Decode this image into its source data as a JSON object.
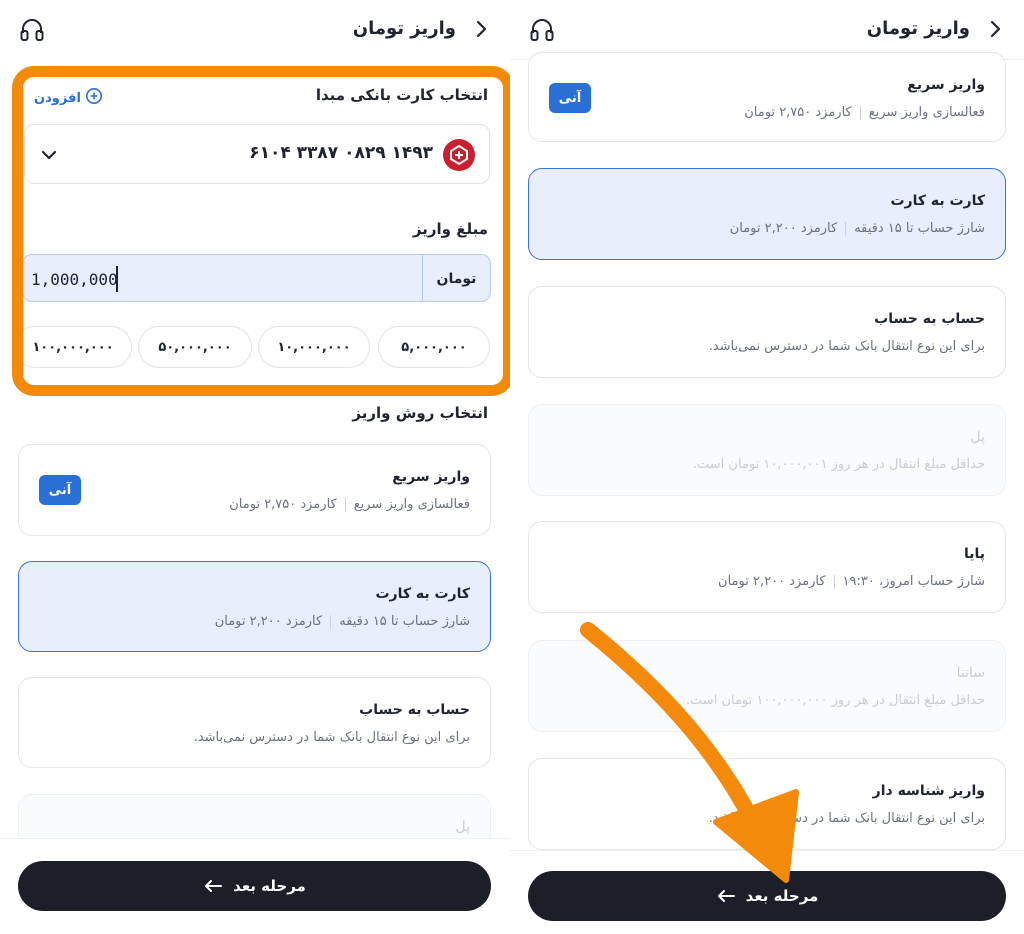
{
  "left": {
    "header": {
      "title": "واریز تومان"
    },
    "source_card": {
      "label": "انتخاب کارت بانکی مبدا",
      "add_label": "افزودن",
      "card_number": "۶۱۰۴ ۳۳۸۷ ۰۸۲۹ ۱۴۹۳"
    },
    "amount": {
      "label": "مبلغ واریز",
      "unit": "تومان",
      "value": "1,000,000",
      "presets": [
        "۵,۰۰۰,۰۰۰",
        "۱۰,۰۰۰,۰۰۰",
        "۵۰,۰۰۰,۰۰۰",
        "۱۰۰,۰۰۰,۰۰۰"
      ]
    },
    "methods_label": "انتخاب روش واریز",
    "methods": [
      {
        "title": "واریز سریع",
        "desc_a": "فعالسازی واریز سریع",
        "desc_b": "کارمزد ۲,۷۵۰ تومان",
        "badge": "آنی"
      },
      {
        "title": "کارت به کارت",
        "desc_a": "شارژ حساب تا ۱۵ دقیقه",
        "desc_b": "کارمزد ۲,۲۰۰ تومان"
      },
      {
        "title": "حساب به حساب",
        "desc": "برای این نوع انتقال بانک شما در دسترس نمی‌باشد."
      },
      {
        "title": "پل"
      }
    ],
    "next_label": "مرحله بعد"
  },
  "right": {
    "header": {
      "title": "واریز تومان"
    },
    "methods": [
      {
        "title": "واریز سریع",
        "desc_a": "فعالسازی واریز سریع",
        "desc_b": "کارمزد ۲,۷۵۰ تومان",
        "badge": "آنی"
      },
      {
        "title": "کارت به کارت",
        "desc_a": "شارژ حساب تا ۱۵ دقیقه",
        "desc_b": "کارمزد ۲,۲۰۰ تومان"
      },
      {
        "title": "حساب به حساب",
        "desc": "برای این نوع انتقال بانک شما در دسترس نمی‌باشد."
      },
      {
        "title": "پل",
        "desc": "حداقل مبلغ انتقال در هر روز ۱۰,۰۰۰,۰۰۱ تومان است."
      },
      {
        "title": "پایا",
        "desc_a": "شارژ حساب امروز، ۱۹:۳۰",
        "desc_b": "کارمزد ۲,۲۰۰ تومان"
      },
      {
        "title": "ساتنا",
        "desc": "حداقل مبلغ انتقال در هر روز ۱۰۰,۰۰۰,۰۰۰ تومان است."
      },
      {
        "title": "واریز شناسه دار",
        "desc": "برای این نوع انتقال بانک شما در دسترس نمی‌باشد."
      }
    ],
    "next_label": "مرحله بعد"
  },
  "colors": {
    "highlight": "#f48a0b",
    "accent": "#2a6fd6",
    "selected_bg": "#e8eefc",
    "button_bg": "#1c1f27",
    "bank_logo": "#c8202f"
  },
  "icons": [
    "back-chevron-icon",
    "headset-icon",
    "plus-circle-icon",
    "bank-logo-icon",
    "chevron-down-icon",
    "arrow-left-icon"
  ]
}
